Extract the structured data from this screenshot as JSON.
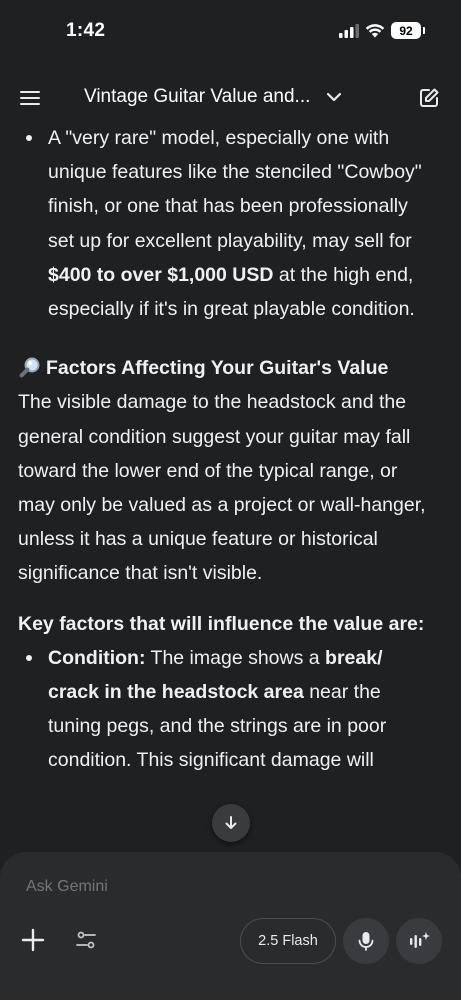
{
  "status": {
    "time": "1:42",
    "battery": "92"
  },
  "header": {
    "title": "Vintage Guitar Value and..."
  },
  "messages": {
    "bullet1": {
      "text_a": "A \"very rare\" model, especially one with unique features like the stenciled \"Cowboy\" finish, or one that has been professionally set up for excellent playability, may sell for ",
      "bold_a": "$400 to over $1,000 USD",
      "text_b": " at the high end, especially if it's in great playable condition."
    },
    "section_heading": "Factors Affecting Your Guitar's Value",
    "section_icon": "magnifying-glass-icon",
    "paragraph": "The visible damage to the headstock and the general condition suggest your guitar may fall toward the lower end of the typical range, or may only be valued as a project or wall-hanger, unless it has a unique feature or historical significance that isn't visible.",
    "key_heading": "Key factors that will influence the value are:",
    "bullet2": {
      "label": "Condition:",
      "text_a": " The image shows a ",
      "bold_a": "break/ crack in the headstock area",
      "text_b": " near the tuning pegs, and the strings are in poor condition. This significant damage will"
    }
  },
  "composer": {
    "placeholder": "Ask Gemini",
    "model_label": "2.5 Flash"
  },
  "icons": {
    "menu": "hamburger-menu-icon",
    "chevron": "chevron-down-icon",
    "edit": "new-chat-edit-icon",
    "plus": "plus-icon",
    "tools": "tools-sliders-icon",
    "mic": "microphone-icon",
    "live": "live-sparkle-icon",
    "scroll": "arrow-down-icon"
  },
  "colors": {
    "background": "#1f2021",
    "composer": "#2a2b2d",
    "text": "#eef0f2"
  }
}
